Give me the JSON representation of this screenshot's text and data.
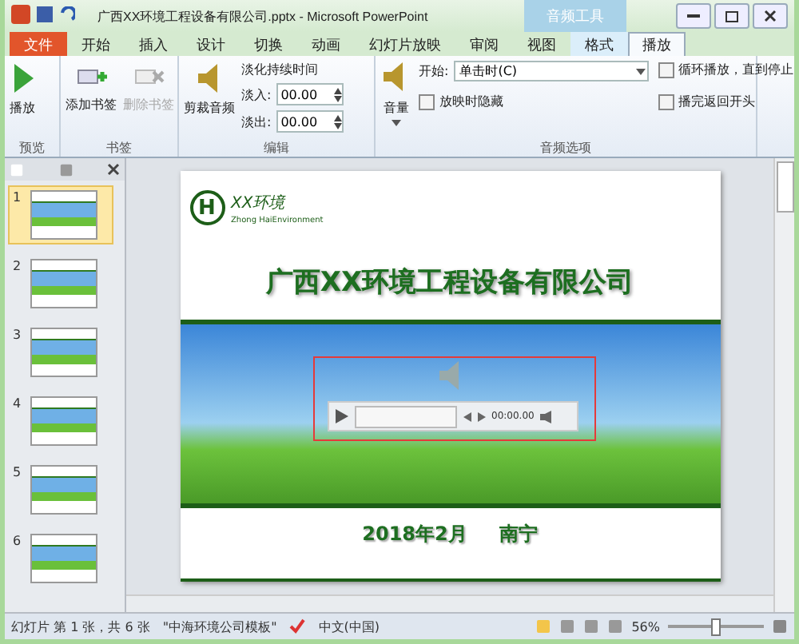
{
  "window": {
    "title": "广西XX环境工程设备有限公司.pptx - Microsoft PowerPoint",
    "context_tab": "音频工具"
  },
  "tabs": [
    {
      "label": "文件",
      "kind": "file",
      "selected": false
    },
    {
      "label": "开始",
      "kind": "normal",
      "selected": false
    },
    {
      "label": "插入",
      "kind": "normal",
      "selected": false
    },
    {
      "label": "设计",
      "kind": "normal",
      "selected": false
    },
    {
      "label": "切换",
      "kind": "normal",
      "selected": false
    },
    {
      "label": "动画",
      "kind": "normal",
      "selected": false
    },
    {
      "label": "幻灯片放映",
      "kind": "normal",
      "selected": false
    },
    {
      "label": "审阅",
      "kind": "normal",
      "selected": false
    },
    {
      "label": "视图",
      "kind": "normal",
      "selected": false
    },
    {
      "label": "格式",
      "kind": "context",
      "selected": false
    },
    {
      "label": "播放",
      "kind": "context",
      "selected": true
    }
  ],
  "ribbon": {
    "preview": {
      "label": "预览",
      "play": "播放"
    },
    "bookmarks": {
      "label": "书签",
      "add": {
        "label": "添加书签",
        "disabled": false
      },
      "remove": {
        "label": "删除书签",
        "disabled": true
      }
    },
    "editing": {
      "label": "编辑",
      "trim": "剪裁音频",
      "fade_title": "淡化持续时间",
      "fade_in": {
        "label": "淡入:",
        "value": "00.00"
      },
      "fade_out": {
        "label": "淡出:",
        "value": "00.00"
      }
    },
    "audio_options": {
      "label": "音频选项",
      "volume": "音量",
      "start_label": "开始:",
      "start_value": "单击时(C)",
      "checks": [
        {
          "label": "放映时隐藏",
          "checked": false
        },
        {
          "label": "循环播放，直到停止",
          "checked": false
        },
        {
          "label": "播完返回开头",
          "checked": false
        }
      ]
    }
  },
  "thumbnails": [
    {
      "number": "1",
      "selected": true
    },
    {
      "number": "2",
      "selected": false
    },
    {
      "number": "3",
      "selected": false
    },
    {
      "number": "4",
      "selected": false
    },
    {
      "number": "5",
      "selected": false
    },
    {
      "number": "6",
      "selected": false
    }
  ],
  "slide": {
    "logo_letter": "H",
    "logo_text": "XX环境",
    "logo_subtext": "Zhong HaiEnvironment",
    "title": "广西XX环境工程设备有限公司",
    "date": "2018年2月",
    "place": "南宁",
    "player_time": "00:00.00"
  },
  "status_bar": {
    "slide_info": "幻灯片 第 1 张，共 6 张",
    "theme": "\"中海环境公司模板\"",
    "language": "中文(中国)",
    "zoom": "56%",
    "zoom_slider": {
      "level": 0.5
    }
  }
}
